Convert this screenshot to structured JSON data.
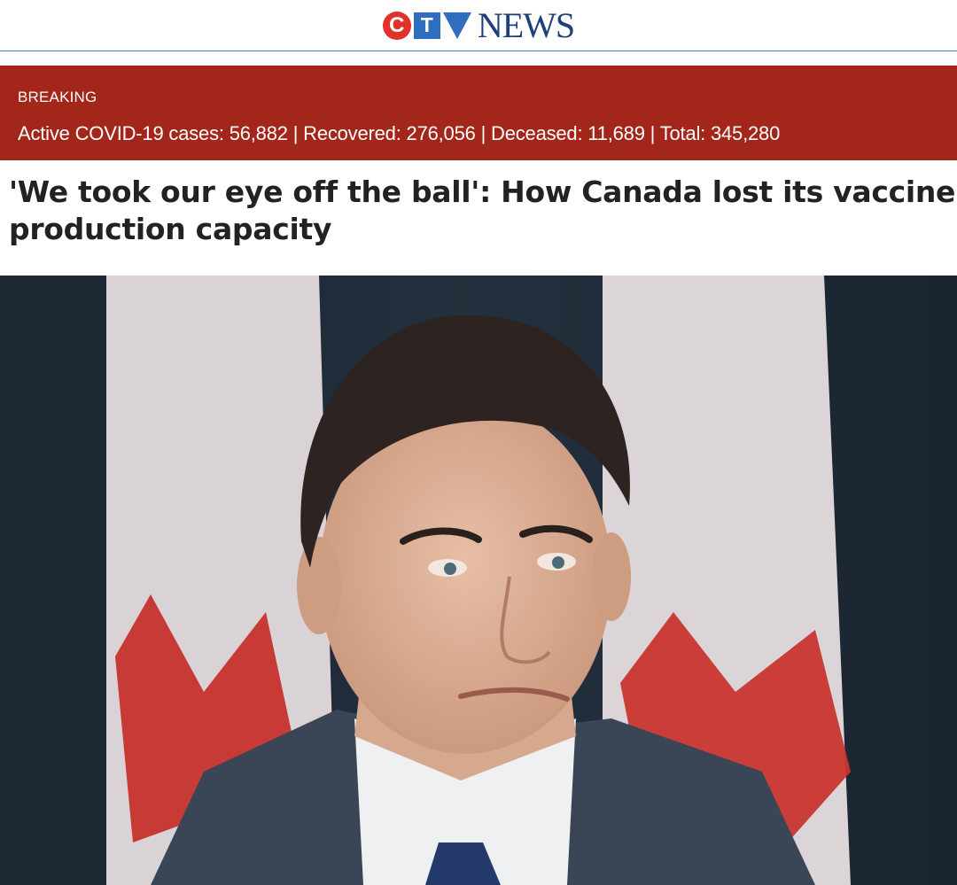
{
  "site": {
    "logo_letters": [
      "C",
      "T",
      "V"
    ],
    "logo_word": "NEWS",
    "brand_colors": {
      "red": "#e0312a",
      "blue": "#2f6dbf",
      "navy": "#1f3f7a"
    }
  },
  "breaking": {
    "label": "BREAKING",
    "stats": "Active COVID-19 cases: 56,882 | Recovered: 276,056 | Deceased: 11,689 | Total: 345,280",
    "background": "#a3261a"
  },
  "article": {
    "headline_line1": "'We took our eye off the ball': How Canada lost its vaccine",
    "headline_line2": "production capacity"
  },
  "hero_image": {
    "subject": "man in suit in front of Canadian flags"
  }
}
